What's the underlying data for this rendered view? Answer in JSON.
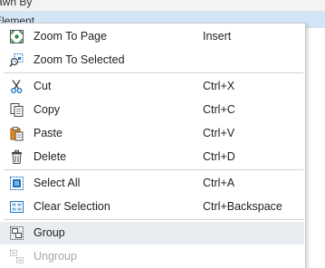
{
  "background": {
    "header_text": "awn By",
    "selected_row_text": "Element"
  },
  "menu": {
    "items": [
      {
        "label": "Zoom To Page",
        "shortcut": "Insert",
        "icon": "zoom-to-page-icon"
      },
      {
        "label": "Zoom To Selected",
        "shortcut": "",
        "icon": "zoom-to-selected-icon"
      },
      {
        "label": "Cut",
        "shortcut": "Ctrl+X",
        "icon": "scissors-icon"
      },
      {
        "label": "Copy",
        "shortcut": "Ctrl+C",
        "icon": "copy-icon"
      },
      {
        "label": "Paste",
        "shortcut": "Ctrl+V",
        "icon": "paste-icon"
      },
      {
        "label": "Delete",
        "shortcut": "Ctrl+D",
        "icon": "trash-icon"
      },
      {
        "label": "Select All",
        "shortcut": "Ctrl+A",
        "icon": "select-all-icon"
      },
      {
        "label": "Clear Selection",
        "shortcut": "Ctrl+Backspace",
        "icon": "clear-selection-icon"
      },
      {
        "label": "Group",
        "shortcut": "",
        "icon": "group-icon",
        "state": "hover"
      },
      {
        "label": "Ungroup",
        "shortcut": "",
        "icon": "ungroup-icon",
        "state": "disabled"
      }
    ]
  },
  "colors": {
    "icon_blue": "#1e73be",
    "icon_orange": "#e08a1e",
    "hover_bg": "#e9edf1",
    "selected_row_bg": "#d3e6f7",
    "disabled_text": "#a8a8a8"
  }
}
